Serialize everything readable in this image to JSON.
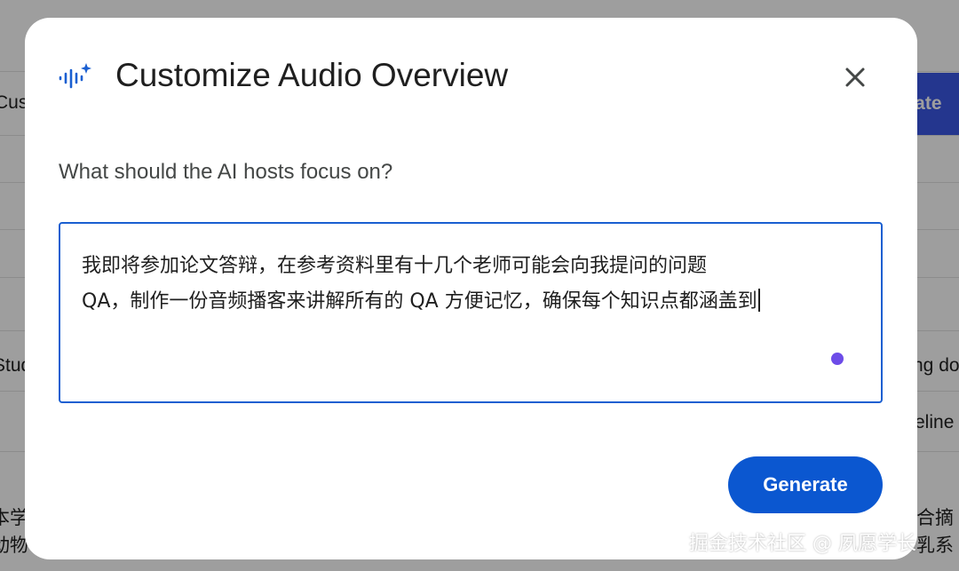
{
  "background": {
    "left_fragments": [
      "Cus",
      "Stud",
      "本学",
      "动物"
    ],
    "right_fragments": [
      "rate",
      "ng do",
      "eline",
      "合摘",
      "乳系"
    ]
  },
  "dialog": {
    "title": "Customize Audio Overview",
    "icon": "audio-sparkle-icon",
    "close_icon": "close-icon",
    "prompt_label": "What should the AI hosts focus on?",
    "textarea": {
      "lines": [
        "我即将参加论文答辩，在参考资料里有十几个老师可能会向我提问的问题",
        "QA，制作一份音频播客来讲解所有的 QA 方便记忆，确保每个知识点都涵盖到"
      ]
    },
    "generate_label": "Generate"
  },
  "watermark": "掘金技术社区 @ 夙愿学长",
  "colors": {
    "accent": "#0b57d0",
    "focus_border": "#1a5fd1",
    "status_dot": "#6d4ce8",
    "icon": "#1a5fd1"
  }
}
